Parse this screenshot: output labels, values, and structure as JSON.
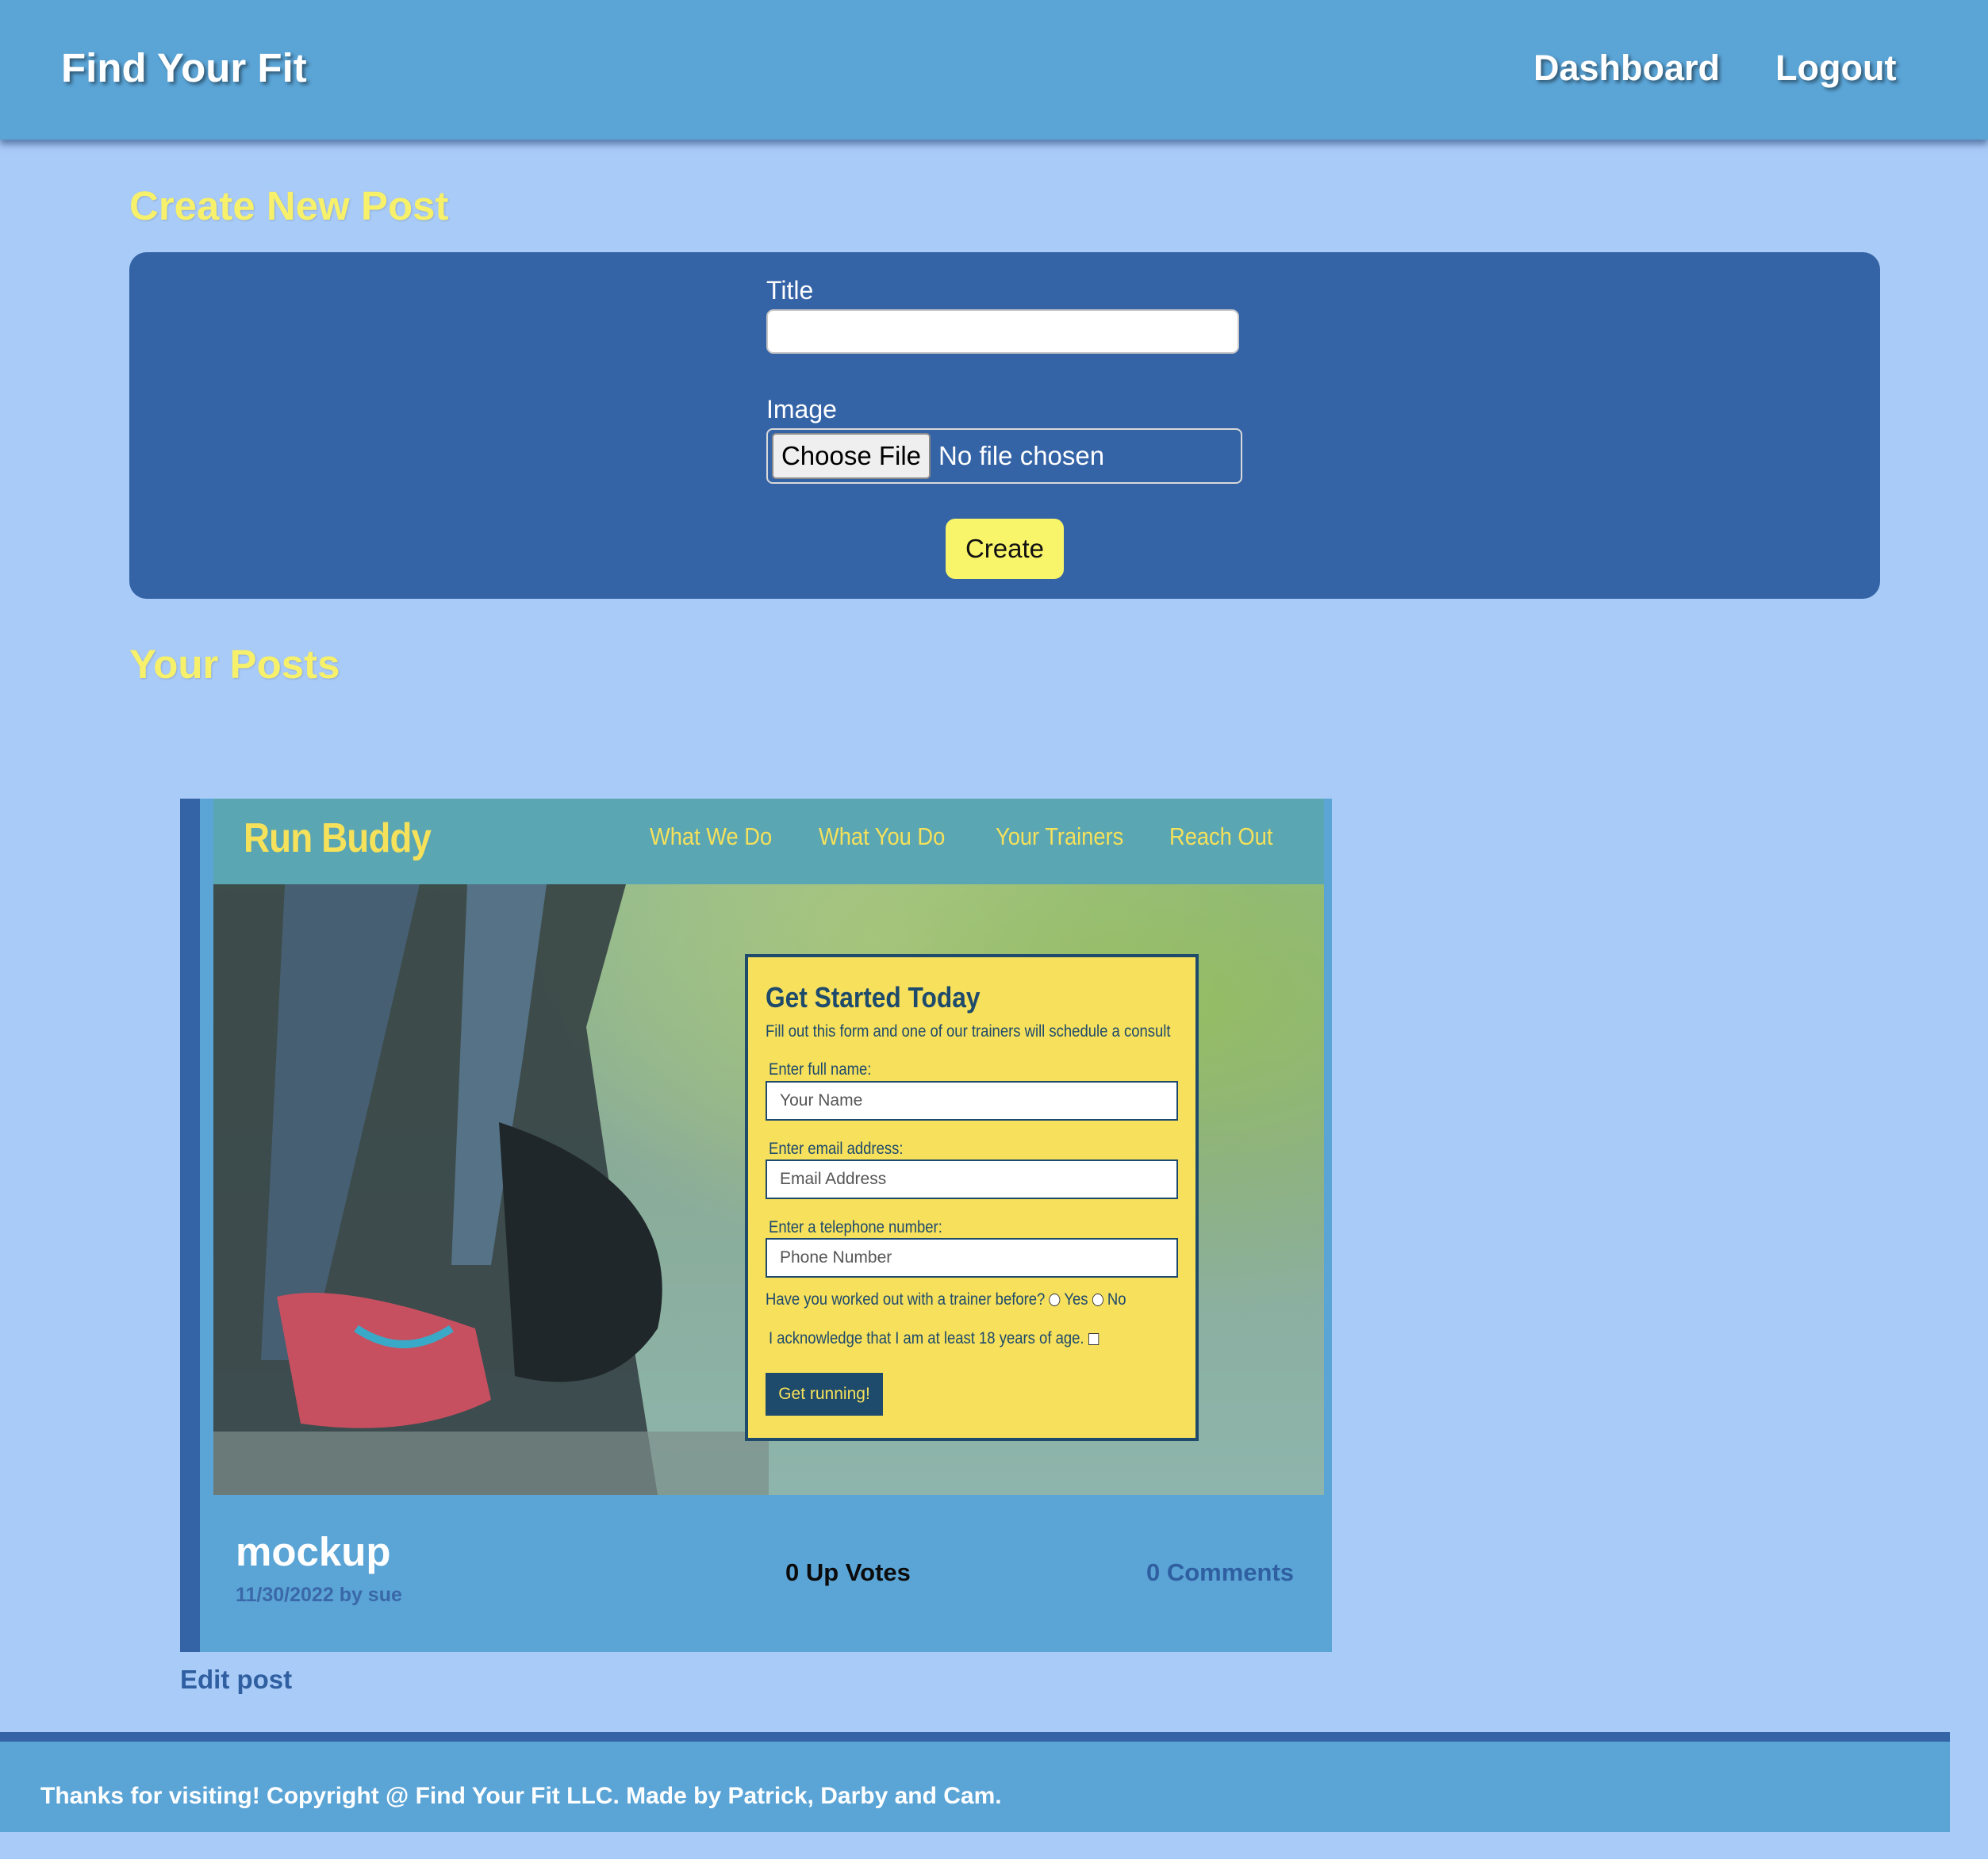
{
  "header": {
    "site_title": "Find Your Fit",
    "nav": {
      "dashboard": "Dashboard",
      "logout": "Logout"
    }
  },
  "create_section": {
    "heading": "Create New Post",
    "title_label": "Title",
    "title_value": "",
    "image_label": "Image",
    "choose_file_label": "Choose File",
    "file_status": "No file chosen",
    "create_button": "Create"
  },
  "posts_section": {
    "heading": "Your Posts",
    "posts": [
      {
        "title": "mockup",
        "meta": "11/30/2022 by sue",
        "votes": "0 Up Votes",
        "comments": "0 Comments",
        "edit_link": "Edit post",
        "image": {
          "logo": "Run Buddy",
          "nav": [
            "What We Do",
            "What You Do",
            "Your Trainers",
            "Reach Out"
          ],
          "form_title": "Get Started Today",
          "form_subtitle": "Fill out this form and one of our trainers will schedule a consult",
          "name_label": "Enter full name:",
          "name_placeholder": "Your Name",
          "email_label": "Enter email address:",
          "email_placeholder": "Email Address",
          "phone_label": "Enter a telephone number:",
          "phone_placeholder": "Phone Number",
          "trainer_question": "Have you worked out with a trainer before?",
          "yes": "Yes",
          "no": "No",
          "age_ack": "I acknowledge that I am at least 18 years of age.",
          "submit": "Get running!"
        }
      }
    ]
  },
  "footer": {
    "text": "Thanks for visiting! Copyright @ Find Your Fit LLC. Made by Patrick, Darby and Cam."
  },
  "colors": {
    "page_bg": "#a9cbf7",
    "header_bg": "#5aa4d6",
    "card_bg": "#3463a6",
    "heading_yellow": "#f7f06a",
    "button_yellow": "#f8f56a"
  }
}
